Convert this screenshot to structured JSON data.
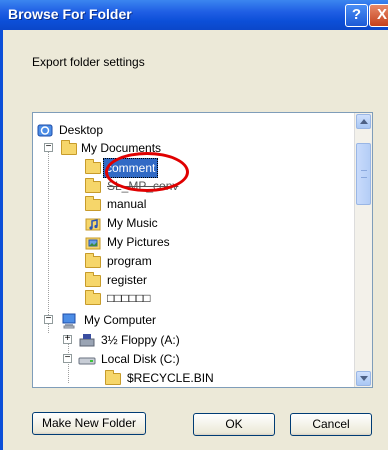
{
  "window": {
    "title": "Browse For Folder",
    "help_label": "?",
    "close_label": "X"
  },
  "description": "Export folder settings",
  "tree": {
    "items": [
      {
        "label": "Desktop",
        "icon": "desktop-icon",
        "expander": ""
      },
      {
        "label": "My Documents",
        "icon": "folder-open-icon",
        "expander": "−"
      },
      {
        "label": "comment",
        "icon": "folder-open-icon",
        "expander": "",
        "selected": true
      },
      {
        "label": "SL_MP_conv",
        "icon": "folder-icon",
        "expander": ""
      },
      {
        "label": "manual",
        "icon": "folder-icon",
        "expander": ""
      },
      {
        "label": "My Music",
        "icon": "music-folder-icon",
        "expander": ""
      },
      {
        "label": "My Pictures",
        "icon": "pictures-folder-icon",
        "expander": ""
      },
      {
        "label": "program",
        "icon": "folder-icon",
        "expander": ""
      },
      {
        "label": "register",
        "icon": "folder-icon",
        "expander": ""
      },
      {
        "label": "□□□□□□",
        "icon": "folder-icon",
        "expander": ""
      },
      {
        "label": "My Computer",
        "icon": "computer-icon",
        "expander": "−"
      },
      {
        "label": "3½ Floppy (A:)",
        "icon": "floppy-icon",
        "expander": "+"
      },
      {
        "label": "Local Disk (C:)",
        "icon": "disk-icon",
        "expander": "−"
      },
      {
        "label": "$RECYCLE.BIN",
        "icon": "folder-icon",
        "expander": ""
      }
    ]
  },
  "buttons": {
    "make_new_folder": "Make New Folder",
    "ok": "OK",
    "cancel": "Cancel"
  },
  "colors": {
    "selection": "#316ac5",
    "annotation_circle": "#e00000",
    "titlebar": "#0b4fd8"
  }
}
